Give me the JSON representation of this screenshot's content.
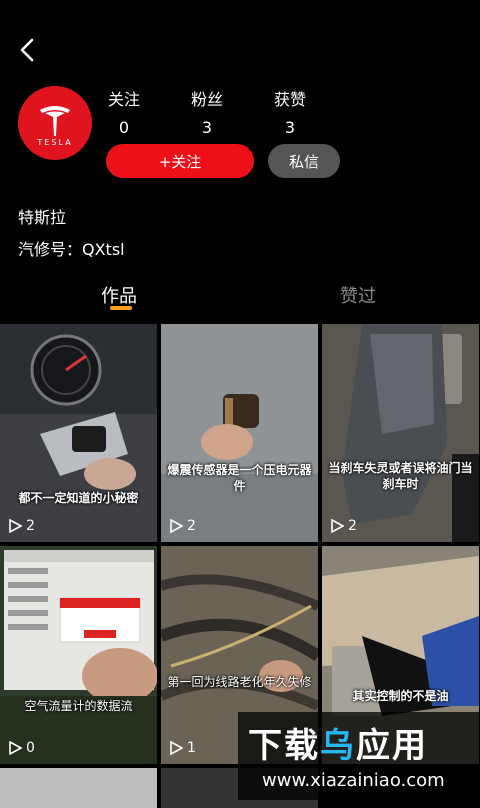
{
  "header": {
    "back_icon": "chevron-left-icon"
  },
  "profile": {
    "logo_text": "TESLA",
    "stats": [
      {
        "label": "关注",
        "value": "0"
      },
      {
        "label": "粉丝",
        "value": "3"
      },
      {
        "label": "获赞",
        "value": "3"
      }
    ],
    "follow_label": "+关注",
    "message_label": "私信",
    "name": "特斯拉",
    "id_line": "汽修号：QXtsl"
  },
  "tabs": [
    {
      "label": "作品",
      "active": true
    },
    {
      "label": "赞过",
      "active": false
    }
  ],
  "videos": [
    {
      "caption": "都不一定知道的小秘密",
      "likes": "2"
    },
    {
      "caption": "爆震传感器是一个压电元器件",
      "likes": "2"
    },
    {
      "caption": "当刹车失灵或者误将油门当刹车时",
      "likes": "2"
    },
    {
      "caption": "空气流量计的数据流",
      "likes": "0"
    },
    {
      "caption": "第一回为线路老化年久失修",
      "likes": "1"
    },
    {
      "caption": "其实控制的不是油",
      "likes": ""
    }
  ],
  "watermark": {
    "title_a": "下载",
    "title_b": "乌",
    "title_c": "应用",
    "url": "www.xiazainiao.com"
  },
  "colors": {
    "accent": "#ee1018",
    "tab_indicator": "#f2a015",
    "brand_red": "#e0141e"
  }
}
